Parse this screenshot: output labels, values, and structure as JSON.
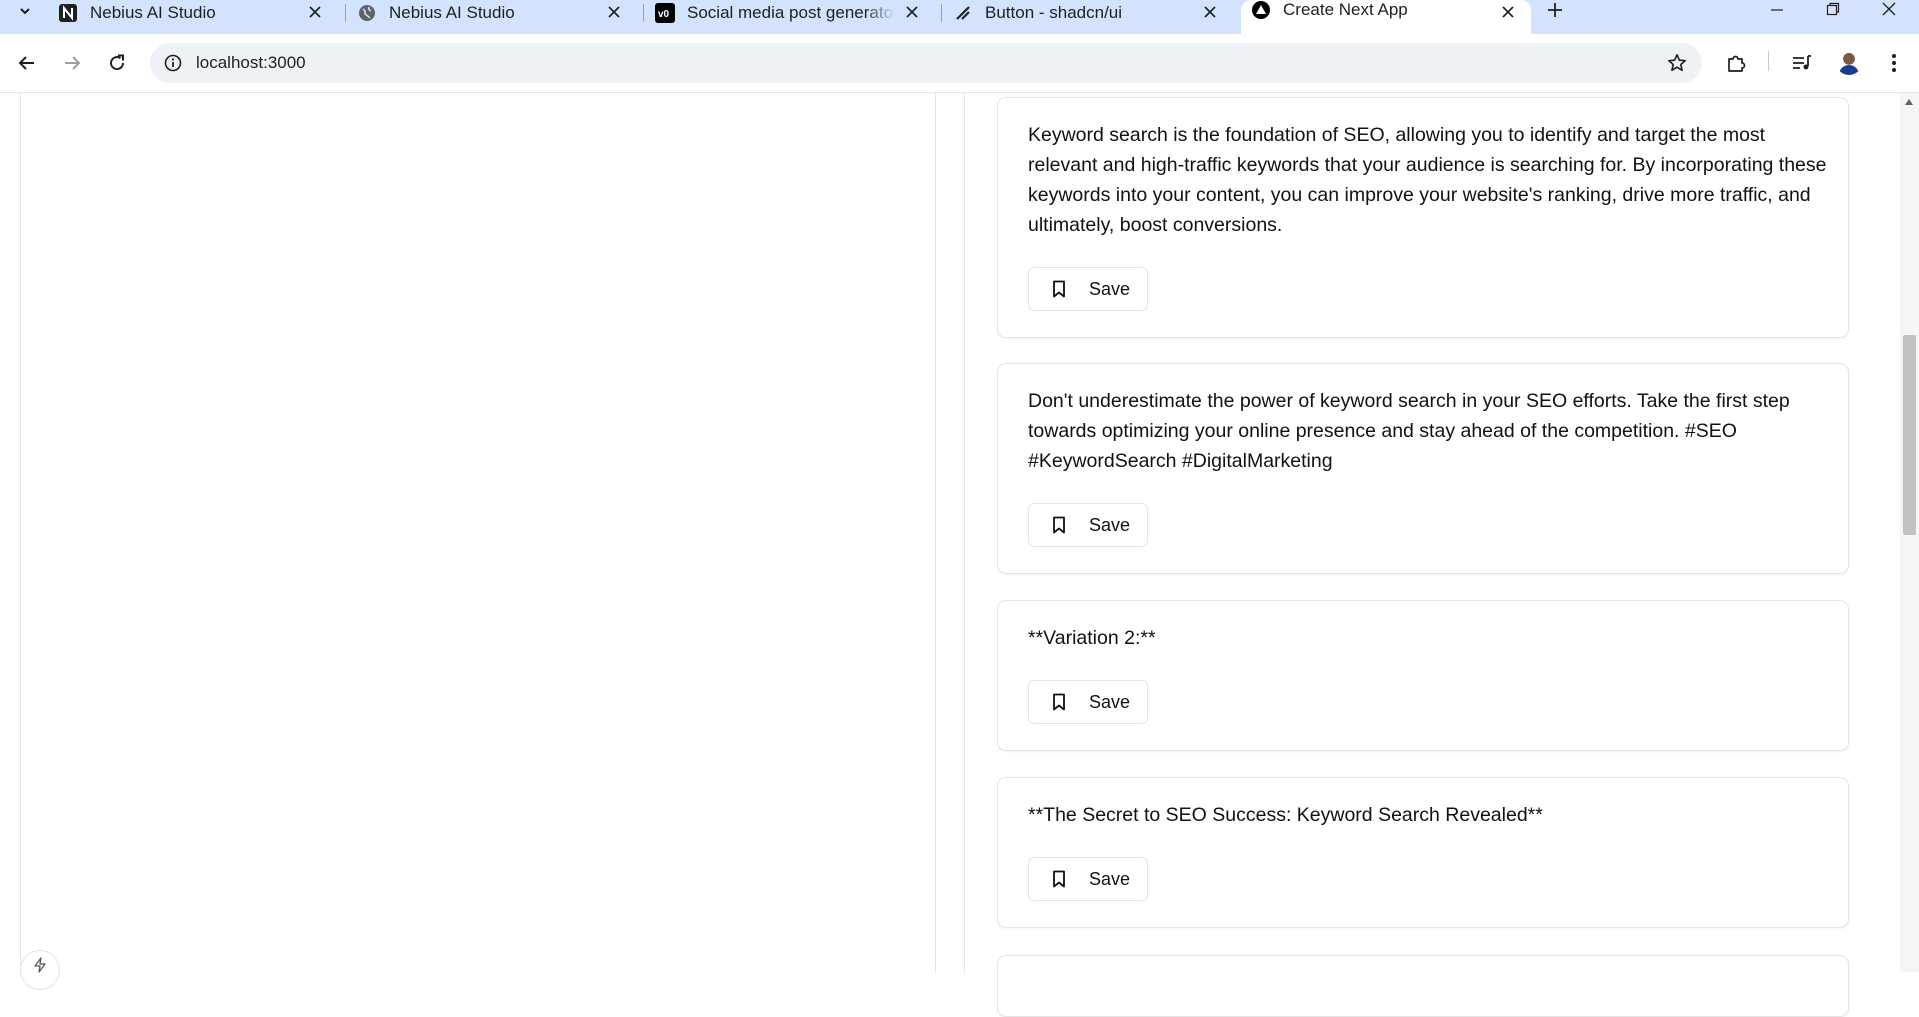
{
  "browser": {
    "tabs": [
      {
        "title": "Nebius AI Studio",
        "favicon": "nebius-logo-icon",
        "active": false
      },
      {
        "title": "Nebius AI Studio",
        "favicon": "globe-icon",
        "active": false
      },
      {
        "title": "Social media post generator - v",
        "favicon": "v0-logo-icon",
        "active": false
      },
      {
        "title": "Button - shadcn/ui",
        "favicon": "shadcn-logo-icon",
        "active": false
      },
      {
        "title": "Create Next App",
        "favicon": "nextjs-logo-icon",
        "active": true
      }
    ],
    "address": "localhost:3000",
    "tab_strip_color": "#d3e3fd"
  },
  "posts": [
    {
      "text": "Keyword search is the foundation of SEO, allowing you to identify and target the most relevant and high-traffic keywords that your audience is searching for. By incorporating these keywords into your content, you can improve your website's ranking, drive more traffic, and ultimately, boost conversions.",
      "save_label": "Save"
    },
    {
      "text": "Don't underestimate the power of keyword search in your SEO efforts. Take the first step towards optimizing your online presence and stay ahead of the competition. #SEO #KeywordSearch #DigitalMarketing",
      "save_label": "Save"
    },
    {
      "text": "**Variation 2:**",
      "save_label": "Save"
    },
    {
      "text": "**The Secret to SEO Success: Keyword Search Revealed**",
      "save_label": "Save"
    }
  ]
}
